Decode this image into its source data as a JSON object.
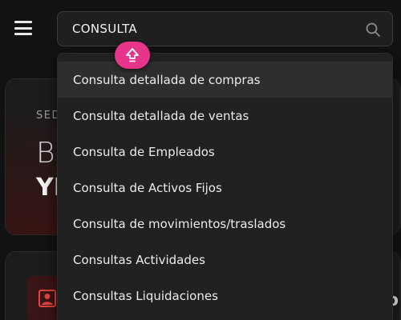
{
  "search": {
    "value": "CONSULTA"
  },
  "dropdown": {
    "items": [
      {
        "label": "Consulta detallada de compras"
      },
      {
        "label": "Consulta detallada de ventas"
      },
      {
        "label": "Consulta de Empleados"
      },
      {
        "label": "Consulta de Activos Fijos"
      },
      {
        "label": "Consulta de movimientos/traslados"
      },
      {
        "label": "Consultas Actividades"
      },
      {
        "label": "Consultas Liquidaciones"
      }
    ]
  },
  "background": {
    "card1": {
      "subtitle": "SED",
      "title": "Bu",
      "bold": "YI"
    },
    "card2": {
      "text": "ro"
    }
  },
  "icons": {
    "menu": "hamburger-icon",
    "search": "search-icon",
    "shift": "shift-up-arrow-icon",
    "card2": "user-id-icon"
  },
  "colors": {
    "accent": "#e6358a",
    "card_icon_bg": "#3a1516",
    "card_icon_fg": "#e0443e"
  }
}
